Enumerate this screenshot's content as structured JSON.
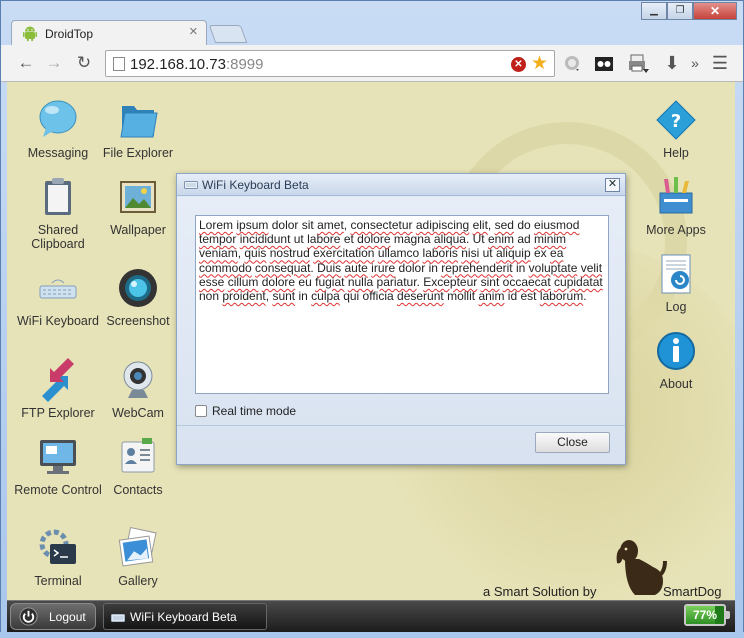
{
  "browser": {
    "tab_title": "DroidTop",
    "url_host": "192.168.10.73",
    "url_port": ":8999",
    "overflow_label": "»"
  },
  "desktop": {
    "left_icons": [
      {
        "label": "Messaging",
        "icon": "chat-bubble-icon"
      },
      {
        "label": "File Explorer",
        "icon": "folder-icon"
      },
      {
        "label": "Shared Clipboard",
        "icon": "clipboard-icon"
      },
      {
        "label": "Wallpaper",
        "icon": "picture-icon"
      },
      {
        "label": "WiFi Keyboard",
        "icon": "keyboard-icon"
      },
      {
        "label": "Screenshot",
        "icon": "camera-lens-icon"
      },
      {
        "label": "FTP Explorer",
        "icon": "transfer-arrows-icon"
      },
      {
        "label": "WebCam",
        "icon": "webcam-icon"
      },
      {
        "label": "Remote Control",
        "icon": "monitor-icon"
      },
      {
        "label": "Contacts",
        "icon": "contacts-icon"
      },
      {
        "label": "Terminal",
        "icon": "terminal-icon"
      },
      {
        "label": "Gallery",
        "icon": "photos-icon"
      }
    ],
    "right_icons": [
      {
        "label": "Help",
        "icon": "help-icon"
      },
      {
        "label": "More Apps",
        "icon": "more-apps-icon"
      },
      {
        "label": "Log",
        "icon": "log-icon"
      },
      {
        "label": "About",
        "icon": "info-icon"
      }
    ],
    "brand_text": "a Smart Solution by",
    "brand_name": "SmartDog"
  },
  "dialog": {
    "title": "WiFi Keyboard Beta",
    "text": "Lorem ipsum dolor sit amet, consectetur adipiscing elit, sed do eiusmod tempor incididunt ut labore et dolore magna aliqua. Ut enim ad minim veniam, quis nostrud exercitation ullamco laboris nisi ut aliquip ex ea commodo consequat. Duis aute irure dolor in reprehenderit in voluptate velit esse cillum dolore eu fugiat nulla pariatur. Excepteur sint occaecat cupidatat non proident, sunt in culpa qui officia deserunt mollit anim id est laborum.",
    "realtime_label": "Real time mode",
    "realtime_checked": false,
    "close_label": "Close"
  },
  "taskbar": {
    "logout_label": "Logout",
    "task_label": "WiFi Keyboard Beta",
    "battery_text": "77%",
    "battery_level": 0.77
  },
  "colors": {
    "desktop_bg": "#e7e3b8",
    "battery_green": "#2e8f24",
    "chrome_frame": "#a9c6ec"
  }
}
